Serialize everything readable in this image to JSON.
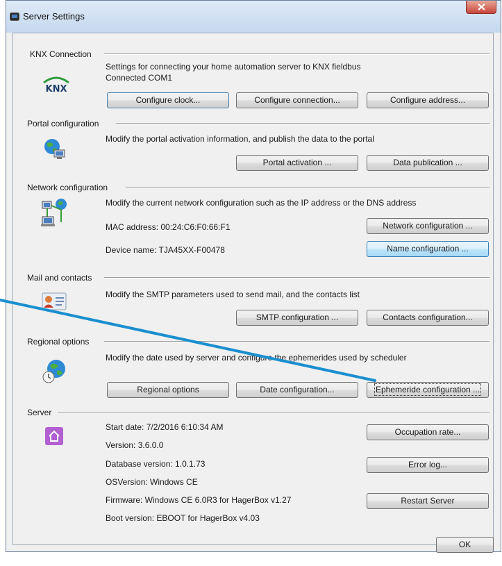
{
  "window": {
    "title": "Server Settings"
  },
  "sections": {
    "knx": {
      "label": "KNX Connection",
      "logo_text": "KNX",
      "description": "Settings for connecting  your home automation server to KNX fieldbus",
      "status": "Connected COM1",
      "buttons": [
        "Configure clock...",
        "Configure connection...",
        "Configure address..."
      ]
    },
    "portal": {
      "label": "Portal configuration",
      "description": "Modify the portal activation information, and publish the data to the portal",
      "buttons": [
        "Portal activation ...",
        "Data publication ..."
      ]
    },
    "network": {
      "label": "Network configuration",
      "description": "Modify the current network configuration such as the IP address or the DNS address",
      "mac": "MAC address: 00:24:C6:F0:66:F1",
      "device": "Device name: TJA45XX-F00478",
      "buttons": [
        "Network configuration ...",
        "Name configuration ..."
      ]
    },
    "mail": {
      "label": "Mail and contacts",
      "description": "Modify the SMTP parameters used to send mail, and the contacts list",
      "buttons": [
        "SMTP configuration ...",
        "Contacts configuration..."
      ]
    },
    "regional": {
      "label": "Regional options",
      "description": "Modify the date used by server and configure the ephemerides used by scheduler",
      "buttons": [
        "Regional options",
        "Date configuration...",
        "Ephemeride configuration ..."
      ]
    },
    "server": {
      "label": "Server",
      "start_date": "Start date: 7/2/2016 6:10:34 AM",
      "version": "Version: 3.6.0.0",
      "db_version": "Database version: 1.0.1.73",
      "os_version": "OSVersion: Windows CE",
      "firmware": "Firmware: Windows CE 6.0R3 for HagerBox v1.27",
      "boot": "Boot version: EBOOT for HagerBox v4.03",
      "buttons": [
        "Occupation rate...",
        "Error log...",
        "Restart Server"
      ]
    }
  },
  "ok_label": "OK",
  "colors": {
    "arrow": "#1a8fd0",
    "knx_green": "#2e9a3a",
    "server_icon": "#b25fd0"
  }
}
